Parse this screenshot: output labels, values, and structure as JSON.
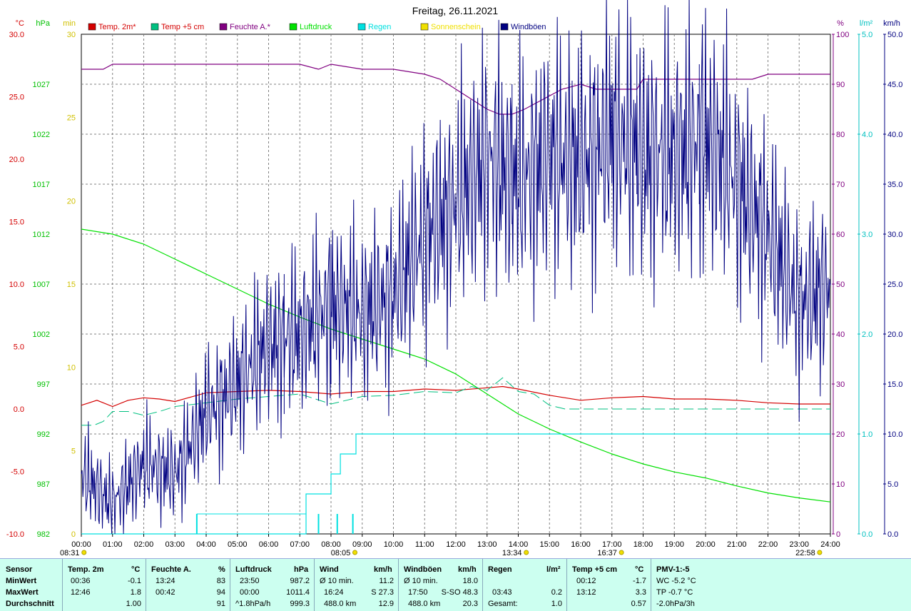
{
  "chart_data": {
    "type": "line",
    "title": "Freitag, 26.11.2021",
    "legend": [
      {
        "label": "Temp. 2m*",
        "color": "#d40000"
      },
      {
        "label": "Temp +5 cm",
        "color": "#00c080"
      },
      {
        "label": "Feuchte A.*",
        "color": "#800080"
      },
      {
        "label": "Luftdruck",
        "color": "#00e000"
      },
      {
        "label": "Regen",
        "color": "#00e0e0"
      },
      {
        "label": "Sonnenschein",
        "color": "#f0e000"
      },
      {
        "label": "Windböen",
        "color": "#000080"
      }
    ],
    "axes": {
      "temp": {
        "unit": "°C",
        "min": -10,
        "max": 30,
        "ticks": [
          "30.0",
          "25.0",
          "20.0",
          "15.0",
          "10.0",
          "5.0",
          "0.0",
          "-5.0",
          "-10.0"
        ],
        "color": "#d40000"
      },
      "pressure": {
        "unit": "hPa",
        "min": 982,
        "max": 1032,
        "ticks": [
          "1027",
          "1022",
          "1017",
          "1012",
          "1007",
          "1002",
          "997",
          "992",
          "987",
          "982"
        ],
        "color": "#00c000"
      },
      "sun": {
        "unit": "min",
        "min": 0,
        "max": 30,
        "ticks": [
          "30",
          "25",
          "20",
          "15",
          "10",
          "5",
          "0"
        ],
        "color": "#d0c000"
      },
      "humidity": {
        "unit": "%",
        "min": 0,
        "max": 100,
        "ticks": [
          "100",
          "90",
          "80",
          "70",
          "60",
          "50",
          "40",
          "30",
          "20",
          "10",
          "0"
        ],
        "color": "#800080"
      },
      "rain": {
        "unit": "l/m²",
        "min": 0,
        "max": 5,
        "ticks": [
          "5.0",
          "4.0",
          "3.0",
          "2.0",
          "1.0",
          "0.0"
        ],
        "color": "#00c0c0"
      },
      "wind": {
        "unit": "km/h",
        "min": 0,
        "max": 50,
        "ticks": [
          "50.0",
          "45.0",
          "40.0",
          "35.0",
          "30.0",
          "25.0",
          "20.0",
          "15.0",
          "10.0",
          "5.0",
          "0.0"
        ],
        "color": "#000080"
      }
    },
    "x_ticks": [
      "00:00",
      "01:00",
      "02:00",
      "03:00",
      "04:00",
      "05:00",
      "06:00",
      "07:00",
      "08:00",
      "09:00",
      "10:00",
      "11:00",
      "12:00",
      "13:00",
      "14:00",
      "15:00",
      "16:00",
      "17:00",
      "18:00",
      "19:00",
      "20:00",
      "21:00",
      "22:00",
      "23:00",
      "24:00"
    ],
    "x_markers": [
      {
        "label": "08:31",
        "hour": -0.6
      },
      {
        "label": "08:05",
        "hour": 8.08
      },
      {
        "label": "13:34",
        "hour": 13.57
      },
      {
        "label": "16:37",
        "hour": 16.62
      },
      {
        "label": "22:58",
        "hour": 22.97
      }
    ],
    "series": [
      {
        "name": "Feuchte A.*",
        "axis": "humidity",
        "color": "#800080",
        "x": [
          0,
          0.7,
          1,
          2,
          3,
          4,
          5,
          6,
          7,
          7.6,
          8,
          9,
          10,
          11,
          11.5,
          12,
          12.5,
          13,
          13.4,
          13.8,
          14.2,
          14.8,
          15.4,
          16,
          16.5,
          17,
          17.8,
          18,
          20,
          21,
          21.5,
          22,
          23,
          24
        ],
        "y": [
          93,
          93,
          94,
          94,
          94,
          94,
          94,
          94,
          94,
          93,
          94,
          93,
          93,
          92,
          91,
          89,
          87,
          85,
          84,
          84,
          85,
          87,
          89,
          90,
          89,
          89,
          89,
          91,
          91,
          91,
          91,
          92,
          92,
          92
        ]
      },
      {
        "name": "Luftdruck",
        "axis": "pressure",
        "color": "#00e000",
        "x": [
          0,
          1,
          2,
          3,
          4,
          5,
          6,
          7,
          8,
          9,
          10,
          11,
          12,
          13,
          14,
          15,
          16,
          17,
          18,
          19,
          20,
          21,
          22,
          23,
          24
        ],
        "y": [
          1012.5,
          1012,
          1011,
          1009.5,
          1008,
          1006.5,
          1005,
          1003.7,
          1002.5,
          1001.5,
          1000.5,
          999.5,
          998,
          996,
          994,
          992.5,
          991.2,
          990,
          989,
          988.2,
          987.6,
          986.8,
          986.1,
          985.6,
          985.2
        ]
      },
      {
        "name": "Temp. 2m*",
        "axis": "temp",
        "color": "#d40000",
        "x": [
          0,
          0.5,
          1,
          1.5,
          2,
          2.5,
          3,
          4,
          5,
          6,
          7,
          8,
          9,
          10,
          11,
          12,
          13,
          13.5,
          14,
          15,
          16,
          17,
          18,
          19,
          20,
          21,
          22,
          23,
          24
        ],
        "y": [
          0.3,
          0.7,
          0.2,
          0.7,
          0.9,
          0.8,
          0.6,
          1.3,
          1.4,
          1.5,
          1.4,
          1.2,
          1.4,
          1.4,
          1.6,
          1.5,
          1.7,
          1.8,
          1.6,
          1.1,
          0.7,
          0.9,
          1.0,
          0.8,
          0.8,
          0.7,
          0.5,
          0.4,
          0.4
        ]
      },
      {
        "name": "Temp +5 cm",
        "axis": "temp",
        "color": "#00c080",
        "x": [
          0,
          0.4,
          0.7,
          1,
          1.5,
          2,
          2.5,
          3,
          4,
          5,
          6,
          7,
          8,
          9,
          10,
          11,
          12,
          12.5,
          13,
          13.5,
          14,
          14.5,
          15,
          15.5,
          16,
          17,
          18,
          19,
          20,
          21,
          22,
          23,
          24
        ],
        "y": [
          -1.3,
          -1.3,
          -1.0,
          -0.2,
          -0.2,
          -0.5,
          -0.2,
          0.2,
          0.5,
          0.8,
          1.0,
          1.2,
          0.4,
          1.0,
          1.1,
          1.4,
          1.3,
          1.8,
          1.5,
          2.5,
          1.4,
          1.2,
          0.3,
          0.0,
          0.0,
          0.0,
          0.0,
          0.0,
          0.0,
          0.0,
          0.0,
          0.0,
          0.0
        ]
      },
      {
        "name": "Regen",
        "axis": "rain",
        "color": "#00e0e0",
        "x": [
          0,
          7.2,
          7.2,
          8.0,
          8.0,
          8.3,
          8.3,
          8.8,
          8.8,
          24
        ],
        "y": [
          0,
          0,
          0.4,
          0.4,
          0.6,
          0.6,
          0.8,
          0.8,
          1.0,
          1.0
        ]
      },
      {
        "name": "Windböen",
        "axis": "wind",
        "color": "#000080",
        "x": [
          0,
          1,
          2,
          3,
          4,
          5,
          6,
          7,
          8,
          9,
          10,
          11,
          12,
          13,
          14,
          15,
          16,
          17,
          18,
          19,
          20,
          21,
          22,
          23,
          24
        ],
        "y": [
          6,
          3,
          7,
          6,
          12,
          15,
          19,
          20,
          23,
          22,
          24,
          30,
          33,
          38,
          35,
          38,
          37,
          40,
          38,
          38,
          40,
          35,
          30,
          23,
          25
        ],
        "peaks": [
          {
            "x": 13.8,
            "y": 45
          },
          {
            "x": 17.8,
            "y": 48
          },
          {
            "x": 19.8,
            "y": 47
          },
          {
            "x": 6.5,
            "y": 26
          },
          {
            "x": 8.0,
            "y": 29
          }
        ]
      }
    ],
    "sun_ticks": [
      {
        "hour": 3.7
      },
      {
        "hour": 7.6
      },
      {
        "hour": 8.2
      },
      {
        "hour": 8.7
      }
    ],
    "grid": true
  },
  "stats": {
    "sensor": {
      "header": "Sensor",
      "rows": [
        "MinWert",
        "MaxWert",
        "Durchschnitt"
      ]
    },
    "temp2m": {
      "header": "Temp. 2m",
      "unit": "°C",
      "rows": [
        [
          "00:36",
          "-0.1"
        ],
        [
          "12:46",
          "1.8"
        ],
        [
          "",
          "1.00"
        ]
      ]
    },
    "feuchte": {
      "header": "Feuchte A.",
      "unit": "%",
      "rows": [
        [
          "13:24",
          "83"
        ],
        [
          "00:42",
          "94"
        ],
        [
          "",
          "91"
        ]
      ]
    },
    "luftdruck": {
      "header": "Luftdruck",
      "unit": "hPa",
      "rows": [
        [
          "23:50",
          "987.2"
        ],
        [
          "00:00",
          "1011.4"
        ],
        [
          "^1.8hPa/h",
          "999.3"
        ]
      ]
    },
    "wind": {
      "header": "Wind",
      "unit": "km/h",
      "rows": [
        [
          "Ø 10 min.",
          "11.2"
        ],
        [
          "16:24",
          "S 27.3"
        ],
        [
          "488.0 km",
          "12.9"
        ]
      ]
    },
    "windboeen": {
      "header": "Windböen",
      "unit": "km/h",
      "rows": [
        [
          "Ø 10 min.",
          "18.0"
        ],
        [
          "17:50",
          "S-SO 48.3"
        ],
        [
          "488.0 km",
          "20.3"
        ]
      ]
    },
    "regen": {
      "header": "Regen",
      "unit": "l/m²",
      "rows": [
        [
          "",
          ""
        ],
        [
          "03:43",
          "0.2"
        ],
        [
          "Gesamt:",
          "1.0"
        ]
      ]
    },
    "temp5": {
      "header": "Temp +5 cm",
      "unit": "°C",
      "rows": [
        [
          "00:12",
          "-1.7"
        ],
        [
          "13:12",
          "3.3"
        ],
        [
          "",
          "0.57"
        ]
      ]
    },
    "pmv": {
      "header": "PMV-1:-5",
      "rows": [
        "WC -5.2 °C",
        "TP -0.7 °C",
        "-2.0hPa/3h"
      ]
    }
  }
}
